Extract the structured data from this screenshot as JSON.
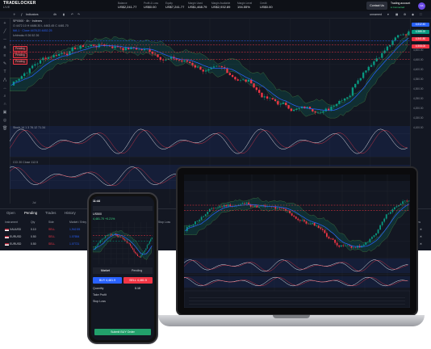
{
  "header": {
    "logo_top": "TRADELOCKER",
    "logo_bottom": "LIVE",
    "metrics": [
      {
        "label": "Balance",
        "value": "US$2,241.77"
      },
      {
        "label": "Profit & Loss",
        "value": "US$0.00"
      },
      {
        "label": "Equity",
        "value": "US$7,241.77"
      },
      {
        "label": "Margin Used",
        "value": "US$1,468.79"
      },
      {
        "label": "Margin Available",
        "value": "US$2,932.89"
      },
      {
        "label": "Margin Level",
        "value": "194.55%"
      },
      {
        "label": "Credit",
        "value": "US$0.00"
      }
    ],
    "contact_label": "Contact Us",
    "account_label": "Trading account",
    "account_sub": "● Connected",
    "avatar_initials": "NA"
  },
  "toolbar": {
    "symbol": "Indicators",
    "timeframe": "4h",
    "saved_layout": "unnamed"
  },
  "chart": {
    "symbol_line": "SPX500 · 4h · Indexes",
    "ohlc": "O 4472.10  H 4488.30  L 4463.45  C 4481.70",
    "ind1": "MA 1 · Close  4478.20  4452.25",
    "ind2": "Ichimoku  9 26 52 26",
    "tags": [
      "Pending",
      "Pending",
      "Pending"
    ],
    "stoch_label": "Stoch  14 1 3  76.12  71.34",
    "osc_label": "CCI  20 Close  112.5",
    "price_labels": [
      "4,600.00",
      "4,550.00",
      "4,500.00",
      "4,450.00",
      "4,400.00",
      "4,350.00",
      "4,300.00",
      "4,250.00",
      "4,200.00",
      "4,150.00",
      "4,100.00"
    ],
    "price_tags": [
      {
        "text": "4,612.40",
        "color": "#2962ff"
      },
      {
        "text": "4,588.20",
        "color": "#089981"
      },
      {
        "text": "4,541.80",
        "color": "#f23645"
      },
      {
        "text": "4,508.00",
        "color": "#f23645"
      }
    ],
    "time_labels": [
      "Jul",
      "Aug",
      "Sep",
      "Oct",
      "Nov",
      "Dec",
      "2024"
    ]
  },
  "bottom": {
    "tabs": [
      "Open",
      "Pending",
      "Trades",
      "History"
    ],
    "active_tab": "Pending",
    "headers": [
      "Instrument",
      "Qty",
      "Side",
      "Market / Entry",
      "Stop Loss",
      "Actions"
    ],
    "rows": [
      {
        "instrument": "XAUUSD",
        "qty": "0.10",
        "side": "SELL",
        "entry": "1,942.55"
      },
      {
        "instrument": "EURUSD",
        "qty": "0.50",
        "side": "SELL",
        "entry": "1.07654"
      },
      {
        "instrument": "EURUSD",
        "qty": "0.50",
        "side": "SELL",
        "entry": "1.07721"
      }
    ]
  },
  "phone": {
    "time": "11:44",
    "symbol": "US500",
    "price_line": "4,481.70  +0.21%",
    "tabs": [
      "Market",
      "Pending"
    ],
    "buy_label": "BUY",
    "sell_label": "SELL",
    "buy_price": "4,481.9",
    "sell_price": "4,481.5",
    "qty_label": "Quantity",
    "qty_value": "0.10",
    "tp_label": "Take Profit",
    "sl_label": "Stop Loss",
    "submit_label": "Submit BUY Order"
  }
}
